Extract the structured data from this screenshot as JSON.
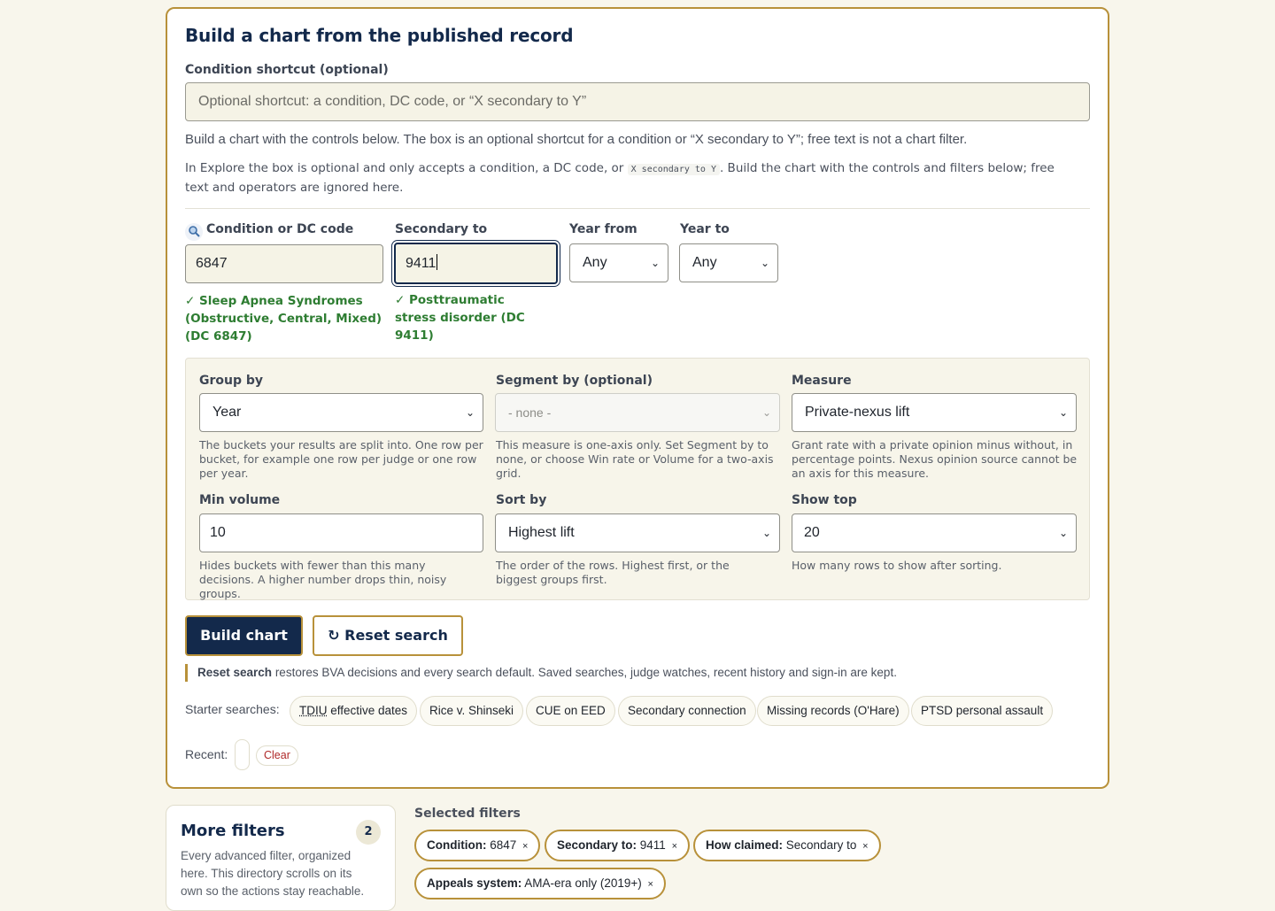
{
  "builder": {
    "title": "Build a chart from the published record",
    "shortcut_label": "Condition shortcut (optional)",
    "shortcut_placeholder": "Optional shortcut: a condition, DC code, or “X secondary to Y”",
    "help_text": "Build a chart with the controls below. The box is an optional shortcut for a condition or “X secondary to Y”; free text is not a chart filter.",
    "explore_text_a": "In Explore the box is optional and only accepts a condition, a DC code, or",
    "explore_code": "X secondary to Y",
    "explore_text_b": ". Build the chart with the controls and filters below; free text and operators are ignored here.",
    "condition": {
      "label": "Condition or DC code",
      "icon": "magnifier-icon",
      "value": "6847",
      "match": "✓ Sleep Apnea Syndromes (Obstructive, Central, Mixed) (DC 6847)"
    },
    "secondary": {
      "label": "Secondary to",
      "value": "9411",
      "match": "✓ Posttraumatic stress disorder (DC 9411)"
    },
    "year_from": {
      "label": "Year from",
      "value": "Any"
    },
    "year_to": {
      "label": "Year to",
      "value": "Any"
    },
    "group_by": {
      "label": "Group by",
      "value": "Year",
      "note": "The buckets your results are split into. One row per bucket, for example one row per judge or one row per year."
    },
    "segment_by": {
      "label": "Segment by (optional)",
      "value": "- none -",
      "note": "This measure is one-axis only. Set Segment by to none, or choose Win rate or Volume for a two-axis grid."
    },
    "measure": {
      "label": "Measure",
      "value": "Private-nexus lift",
      "note": "Grant rate with a private opinion minus without, in percentage points. Nexus opinion source cannot be an axis for this measure."
    },
    "min_volume": {
      "label": "Min volume",
      "value": "10",
      "note": "Hides buckets with fewer than this many decisions. A higher number drops thin, noisy groups."
    },
    "sort_by": {
      "label": "Sort by",
      "value": "Highest lift",
      "note": "The order of the rows. Highest first, or the biggest groups first."
    },
    "show_top": {
      "label": "Show top",
      "value": "20",
      "note": "How many rows to show after sorting."
    },
    "build_button": "Build chart",
    "reset_button": "↻ Reset search",
    "reset_note_bold": "Reset search",
    "reset_note_rest": " restores BVA decisions and every search default. Saved searches, judge watches, recent history and sign-in are kept.",
    "starter_label": "Starter searches:",
    "starters": [
      {
        "abbr": "TDIU",
        "rest": " effective dates"
      },
      {
        "label": "Rice v. Shinseki"
      },
      {
        "label": "CUE on EED"
      },
      {
        "label": "Secondary connection"
      },
      {
        "label": "Missing records (O'Hare)"
      },
      {
        "label": "PTSD personal assault"
      }
    ],
    "recent_label": "Recent:",
    "clear_label": "Clear"
  },
  "more_filters": {
    "title": "More filters",
    "count": "2",
    "description": "Every advanced filter, organized here. This directory scrolls on its own so the actions stay reachable."
  },
  "selected_filters": {
    "label": "Selected filters",
    "chips": [
      {
        "key": "Condition:",
        "value": " 6847",
        "x": "×"
      },
      {
        "key": "Secondary to:",
        "value": " 9411",
        "x": "×"
      },
      {
        "key": "How claimed:",
        "value": " Secondary to",
        "x": "×"
      },
      {
        "key": "Appeals system:",
        "value": " AMA-era only (2019+)",
        "x": "×"
      }
    ]
  },
  "colors": {
    "accent_gold": "#b8913a",
    "navy": "#13294b",
    "success_green": "#2e7d32",
    "clear_red": "#b02a2a"
  }
}
